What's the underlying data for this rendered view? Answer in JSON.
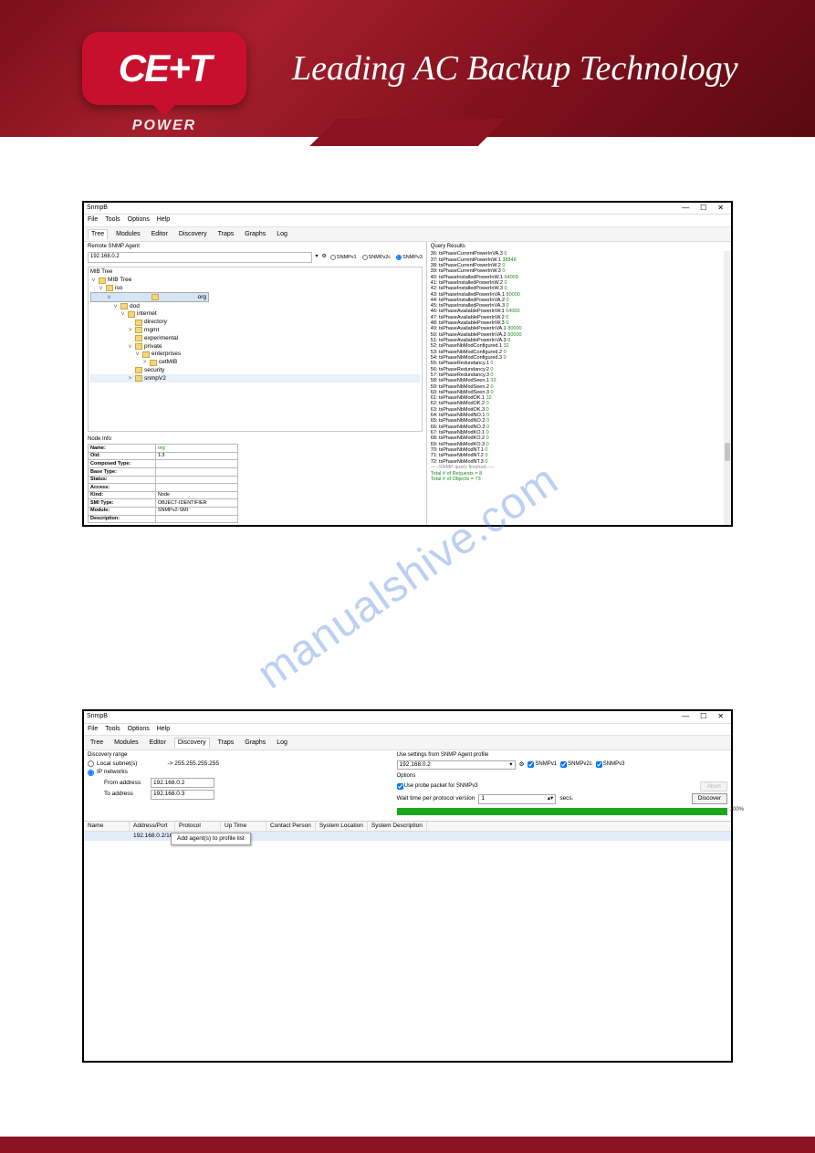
{
  "header": {
    "logo_text": "CE+T",
    "logo_sub": "POWER",
    "tagline": "Leading AC Backup Technology"
  },
  "watermark": "manualshive.com",
  "shot1": {
    "title": "SnmpB",
    "menus": [
      "File",
      "Tools",
      "Options",
      "Help"
    ],
    "tabs": [
      "Tree",
      "Modules",
      "Editor",
      "Discovery",
      "Traps",
      "Graphs",
      "Log"
    ],
    "agent_label": "Remote SNMP Agent",
    "agent_value": "192.168.0.2",
    "protocols": [
      {
        "label": "SNMPv1",
        "checked": false
      },
      {
        "label": "SNMPv2c",
        "checked": false
      },
      {
        "label": "SNMPv3",
        "checked": true
      }
    ],
    "tree_label": "MIB Tree",
    "tree": [
      {
        "indent": 0,
        "toggle": "v",
        "label": "MIB Tree"
      },
      {
        "indent": 1,
        "toggle": "v",
        "label": "iso"
      },
      {
        "indent": 2,
        "toggle": "v",
        "label": "org",
        "sel": true
      },
      {
        "indent": 3,
        "toggle": "v",
        "label": "dod"
      },
      {
        "indent": 4,
        "toggle": "v",
        "label": "internet"
      },
      {
        "indent": 5,
        "toggle": " ",
        "label": "directory"
      },
      {
        "indent": 5,
        "toggle": ">",
        "label": "mgmt"
      },
      {
        "indent": 5,
        "toggle": " ",
        "label": "experimental"
      },
      {
        "indent": 5,
        "toggle": "v",
        "label": "private"
      },
      {
        "indent": 6,
        "toggle": "v",
        "label": "enterprises"
      },
      {
        "indent": 7,
        "toggle": ">",
        "label": "cetMIB"
      },
      {
        "indent": 5,
        "toggle": " ",
        "label": "security"
      },
      {
        "indent": 5,
        "toggle": ">",
        "label": "snmpV2",
        "sel2": true
      }
    ],
    "nodeinfo_label": "Node Info",
    "nodeinfo": [
      [
        "Name:",
        "org"
      ],
      [
        "Oid:",
        "1.3"
      ],
      [
        "Composed Type:",
        ""
      ],
      [
        "Base Type:",
        ""
      ],
      [
        "Status:",
        ""
      ],
      [
        "Access:",
        ""
      ],
      [
        "Kind:",
        "Node"
      ],
      [
        "SMI Type:",
        "OBJECT-IDENTIFIER"
      ],
      [
        "Module:",
        "SNMPv2-SMI"
      ],
      [
        "Description:",
        ""
      ]
    ],
    "query_header": "Query Results",
    "query_lines": [
      {
        "n": "36",
        "oid": "tsPhaseCurrentPowerInVA.3",
        "v": "0"
      },
      {
        "n": "37",
        "oid": "tsPhaseCurrentPowerInW.1",
        "v": "38848"
      },
      {
        "n": "38",
        "oid": "tsPhaseCurrentPowerInW.2",
        "v": "0"
      },
      {
        "n": "39",
        "oid": "tsPhaseCurrentPowerInW.3",
        "v": "0"
      },
      {
        "n": "40",
        "oid": "tsPhaseInstalledPowerInW.1",
        "v": "64000"
      },
      {
        "n": "41",
        "oid": "tsPhaseInstalledPowerInW.2",
        "v": "0"
      },
      {
        "n": "42",
        "oid": "tsPhaseInstalledPowerInW.3",
        "v": "0"
      },
      {
        "n": "43",
        "oid": "tsPhaseInstalledPowerInVA.1",
        "v": "80000"
      },
      {
        "n": "44",
        "oid": "tsPhaseInstalledPowerInVA.2",
        "v": "0"
      },
      {
        "n": "45",
        "oid": "tsPhaseInstalledPowerInVA.3",
        "v": "0"
      },
      {
        "n": "46",
        "oid": "tsPhaseAvailablePowerInW.1",
        "v": "64000"
      },
      {
        "n": "47",
        "oid": "tsPhaseAvailablePowerInW.2",
        "v": "0"
      },
      {
        "n": "48",
        "oid": "tsPhaseAvailablePowerInW.3",
        "v": "0"
      },
      {
        "n": "49",
        "oid": "tsPhaseAvailablePowerInVA.1",
        "v": "80000"
      },
      {
        "n": "50",
        "oid": "tsPhaseAvailablePowerInVA.2",
        "v": "80000"
      },
      {
        "n": "51",
        "oid": "tsPhaseAvailablePowerInVA.3",
        "v": "0"
      },
      {
        "n": "52",
        "oid": "tsPhaseNbModConfigured.1",
        "v": "32"
      },
      {
        "n": "53",
        "oid": "tsPhaseNbModConfigured.2",
        "v": "0"
      },
      {
        "n": "54",
        "oid": "tsPhaseNbModConfigured.3",
        "v": "0"
      },
      {
        "n": "55",
        "oid": "tsPhaseRedundancy.1",
        "v": "0"
      },
      {
        "n": "56",
        "oid": "tsPhaseRedundancy.2",
        "v": "0"
      },
      {
        "n": "57",
        "oid": "tsPhaseRedundancy.3",
        "v": "0"
      },
      {
        "n": "58",
        "oid": "tsPhaseNbModSeen.1",
        "v": "32"
      },
      {
        "n": "59",
        "oid": "tsPhaseNbModSeen.2",
        "v": "0"
      },
      {
        "n": "60",
        "oid": "tsPhaseNbModSeen.3",
        "v": "0"
      },
      {
        "n": "61",
        "oid": "tsPhaseNbModOK.1",
        "v": "32"
      },
      {
        "n": "62",
        "oid": "tsPhaseNbModOK.2",
        "v": "0"
      },
      {
        "n": "63",
        "oid": "tsPhaseNbModOK.3",
        "v": "0"
      },
      {
        "n": "64",
        "oid": "tsPhaseNbModNO.1",
        "v": "0"
      },
      {
        "n": "65",
        "oid": "tsPhaseNbModNO.2",
        "v": "0"
      },
      {
        "n": "66",
        "oid": "tsPhaseNbModNO.3",
        "v": "0"
      },
      {
        "n": "67",
        "oid": "tsPhaseNbModKO.1",
        "v": "0"
      },
      {
        "n": "68",
        "oid": "tsPhaseNbModKO.2",
        "v": "0"
      },
      {
        "n": "69",
        "oid": "tsPhaseNbModKO.3",
        "v": "0"
      },
      {
        "n": "70",
        "oid": "tsPhaseNbModNT.1",
        "v": "0"
      },
      {
        "n": "71",
        "oid": "tsPhaseNbModNT.2",
        "v": "0"
      },
      {
        "n": "72",
        "oid": "tsPhaseNbModNT.3",
        "v": "0"
      }
    ],
    "query_end": "-----SNMP query finished-----",
    "query_totals": [
      "Total # of Requests = 8",
      "Total # of Objects = 73"
    ]
  },
  "shot2": {
    "title": "SnmpB",
    "menus": [
      "File",
      "Tools",
      "Options",
      "Help"
    ],
    "tabs": [
      "Tree",
      "Modules",
      "Editor",
      "Discovery",
      "Traps",
      "Graphs",
      "Log"
    ],
    "active_tab": "Discovery",
    "range_label": "Discovery range",
    "local_label": "Local subnet(s)",
    "local_suffix": "-> 255.255.255.255",
    "ip_label": "IP networks",
    "from_label": "From address",
    "from_value": "192.168.0.2",
    "to_label": "To address",
    "to_value": "192.168.0.3",
    "profile_label": "Use settings from SNMP Agent profile",
    "profile_value": "192.168.0.2",
    "proto_checks": [
      {
        "label": "SNMPv1",
        "checked": true
      },
      {
        "label": "SNMPv2c",
        "checked": true
      },
      {
        "label": "SNMPv3",
        "checked": true
      }
    ],
    "options_label": "Options",
    "probe_label": "Use probe packet for SNMPv3",
    "probe_checked": true,
    "wait_label": "Wait time per protocol version",
    "wait_value": "1",
    "wait_unit": "secs.",
    "btn_abort": "Abort",
    "btn_discover": "Discover",
    "progress_pct": "100%",
    "table_headers": [
      "Name",
      "Address/Port",
      "Protocol",
      "Up Time",
      "Contact Person",
      "System Location",
      "System Description"
    ],
    "table_row": {
      "addr": "192.168.0.2/161"
    },
    "context_menu": "Add agent(s) to profile list"
  }
}
